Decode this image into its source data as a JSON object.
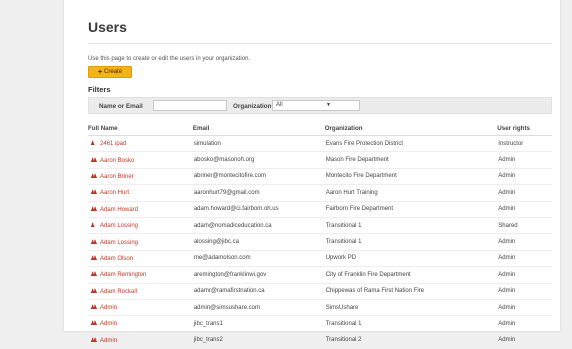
{
  "page": {
    "title": "Users",
    "intro": "Use this page to create or edit the users in your organization.",
    "create_label": "Create",
    "filters_heading": "Filters"
  },
  "filters": {
    "name_label": "Name or Email",
    "name_value": "",
    "org_label": "Organization",
    "org_value": "All"
  },
  "table": {
    "headers": [
      "Full Name",
      "Email",
      "Organization",
      "User rights"
    ],
    "rows": [
      {
        "icon": "single-user-icon",
        "name": "2461 ipad",
        "email": "simulation",
        "org": "Evans Fire Protection District",
        "rights": "Instructor"
      },
      {
        "icon": "multi-user-icon",
        "name": "Aaron Bosko",
        "email": "abosko@masonoh.org",
        "org": "Mason Fire Department",
        "rights": "Admin"
      },
      {
        "icon": "multi-user-icon",
        "name": "Aaron Briner",
        "email": "abriner@montecitofire.com",
        "org": "Montecito Fire Department",
        "rights": "Admin"
      },
      {
        "icon": "multi-user-icon",
        "name": "Aaron Hurt",
        "email": "aaronhurt79@gmail.com",
        "org": "Aaron Hurt Training",
        "rights": "Admin"
      },
      {
        "icon": "multi-user-icon",
        "name": "Adam Howard",
        "email": "adam.howard@ci.fairbom.oh.us",
        "org": "Fairborn Fire Department",
        "rights": "Admin"
      },
      {
        "icon": "single-user-icon",
        "name": "Adam Lossing",
        "email": "adam@nomadiceducation.ca",
        "org": "Transitional 1",
        "rights": "Shared"
      },
      {
        "icon": "multi-user-icon",
        "name": "Adam Lossing",
        "email": "alossing@jibc.ca",
        "org": "Transitional 1",
        "rights": "Admin"
      },
      {
        "icon": "multi-user-icon",
        "name": "Adam Olson",
        "email": "me@adamolson.com",
        "org": "Upwork PD",
        "rights": "Admin"
      },
      {
        "icon": "multi-user-icon",
        "name": "Adam Remington",
        "email": "aremington@franklinwi.gov",
        "org": "City of Franklin Fire Department",
        "rights": "Admin"
      },
      {
        "icon": "multi-user-icon",
        "name": "Adam Rockall",
        "email": "adamr@ramafirstnation.ca",
        "org": "Chippewas of Rama First Nation Fire",
        "rights": "Admin"
      },
      {
        "icon": "multi-user-icon",
        "name": "Admin",
        "email": "admin@simsushare.com",
        "org": "SimsUshare",
        "rights": "Admin"
      },
      {
        "icon": "multi-user-icon",
        "name": "Admin",
        "email": "jibc_trans1",
        "org": "Transitional 1",
        "rights": "Admin"
      },
      {
        "icon": "multi-user-icon",
        "name": "Admin",
        "email": "jibc_trans2",
        "org": "Transitional 2",
        "rights": "Admin"
      }
    ]
  },
  "colors": {
    "accent": "#f3b41a",
    "link": "#c0392b"
  }
}
